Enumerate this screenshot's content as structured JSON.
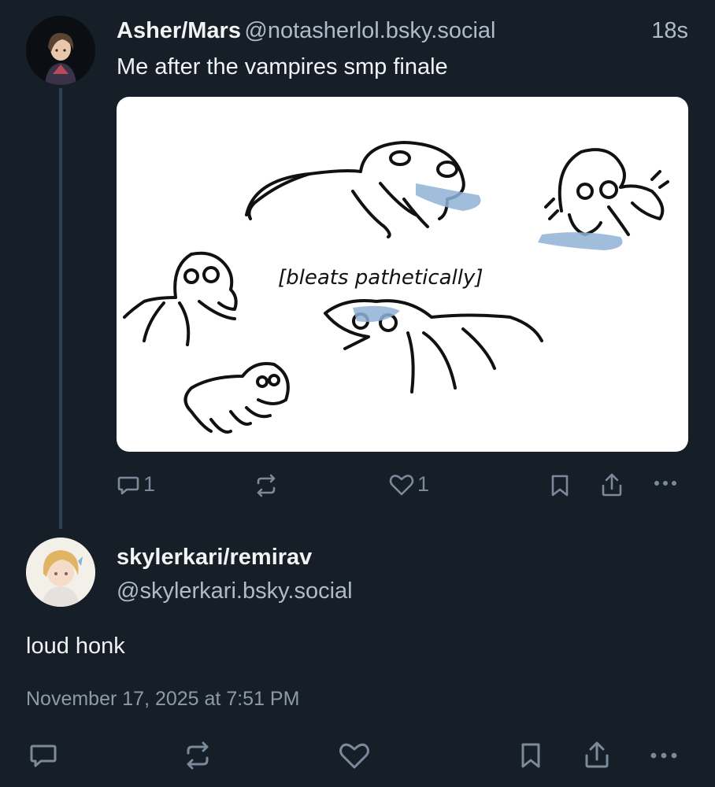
{
  "parent_post": {
    "display_name": "Asher/Mars",
    "handle": "@notasherlol.bsky.social",
    "time_ago": "18s",
    "text": "Me after the vampires smp finale",
    "image_caption": "[bleats pathetically]",
    "actions": {
      "reply_count": "1",
      "like_count": "1"
    },
    "avatar_icon": "user-avatar-dark-haired"
  },
  "main_post": {
    "display_name": "skylerkari/remirav",
    "handle": "@skylerkari.bsky.social",
    "text": "loud honk",
    "timestamp": "November 17, 2025 at 7:51 PM",
    "avatar_icon": "user-avatar-blonde"
  },
  "colors": {
    "background": "#161e27",
    "icon": "#7b8a9a",
    "thread_line": "#2e4052"
  }
}
